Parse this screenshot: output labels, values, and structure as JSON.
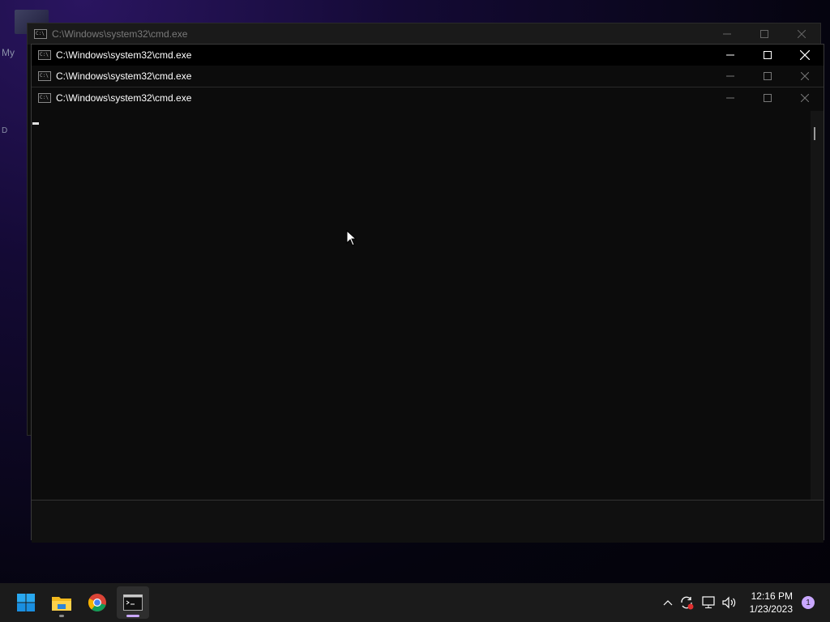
{
  "desktop": {
    "labels": [
      "My",
      "D"
    ]
  },
  "windows": [
    {
      "title": "C:\\Windows\\system32\\cmd.exe",
      "state": "inactive-back"
    },
    {
      "title": "C:\\Windows\\system32\\cmd.exe",
      "state": "active"
    },
    {
      "title": "C:\\Windows\\system32\\cmd.exe",
      "state": "inactive"
    },
    {
      "title": "C:\\Windows\\system32\\cmd.exe",
      "state": "inactive"
    }
  ],
  "controls": {
    "minimize": "minimize-icon",
    "maximize": "maximize-icon",
    "close": "close-icon"
  },
  "taskbar": {
    "apps": [
      "start-icon",
      "file-explorer-icon",
      "chrome-icon",
      "command-prompt-icon"
    ],
    "tray_icons": [
      "chevron-up-icon",
      "sync-icon",
      "network-icon",
      "volume-icon"
    ],
    "time": "12:16 PM",
    "date": "1/23/2023",
    "notification_count": "1"
  },
  "colors": {
    "terminal_bg": "#0c0c0c",
    "taskbar_bg": "#1b1b1b",
    "accent": "#0078d4"
  }
}
